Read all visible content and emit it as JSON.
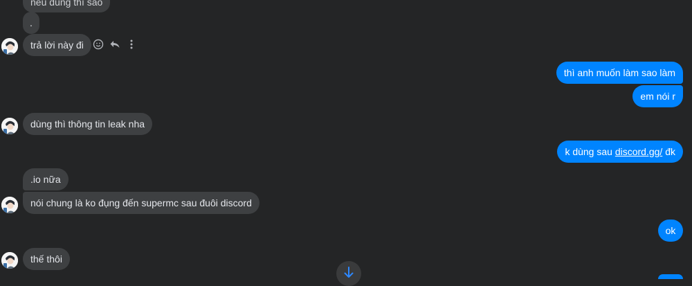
{
  "messages": {
    "m1": "nếu dùng thì sao",
    "m2": ".",
    "m3": "trả lời này đi",
    "m4": "thì anh muốn làm sao làm",
    "m5": "em nói r",
    "m6": "dùng thì thông tin leak nha",
    "m7_prefix": "k dùng sau ",
    "m7_link": "discord.gg/",
    "m7_suffix": " đk",
    "m8": ".io nữa",
    "m9": "nói chung là ko đụng đến supermc sau đuôi discord",
    "m10": "ok",
    "m11": "thế thôi"
  },
  "icons": {
    "react": "smiley-icon",
    "reply": "reply-icon",
    "more": "more-vertical-icon",
    "scroll": "arrow-down-icon"
  },
  "colors": {
    "background": "#242526",
    "incoming_bubble": "#3e4042",
    "outgoing_bubble": "#0084ff",
    "text": "#e4e6eb"
  }
}
